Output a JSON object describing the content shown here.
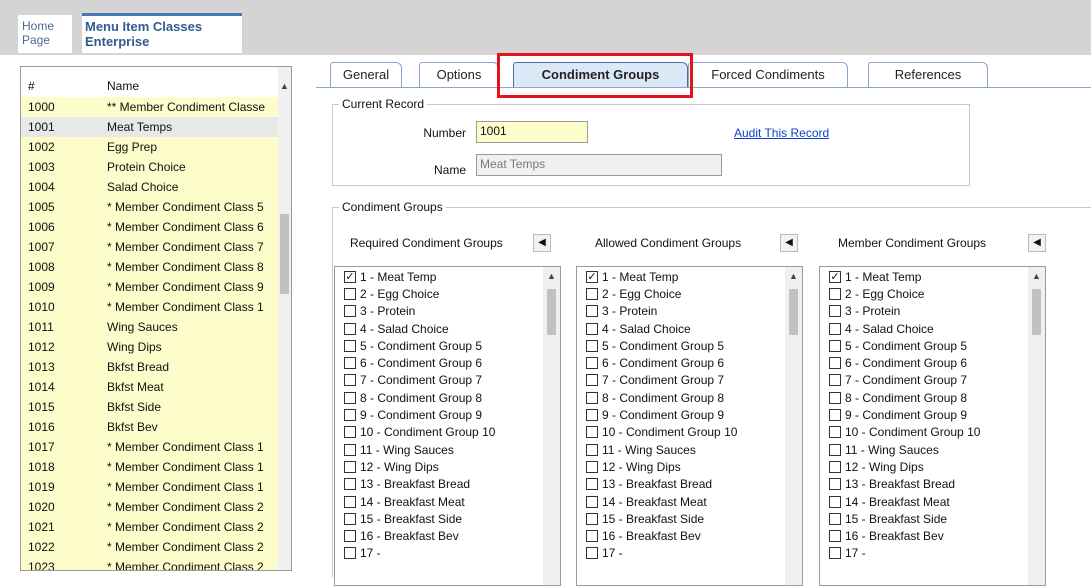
{
  "breadcrumb": {
    "home_line1": "Home",
    "home_line2": "Page",
    "active_line1": "Menu Item Classes",
    "active_line2": "Enterprise"
  },
  "list": {
    "col_num": "#",
    "col_name": "Name",
    "rows": [
      {
        "num": "1000",
        "name": "** Member Condiment Classe"
      },
      {
        "num": "1001",
        "name": "Meat Temps"
      },
      {
        "num": "1002",
        "name": "Egg Prep"
      },
      {
        "num": "1003",
        "name": "Protein Choice"
      },
      {
        "num": "1004",
        "name": "Salad Choice"
      },
      {
        "num": "1005",
        "name": "* Member Condiment Class 5"
      },
      {
        "num": "1006",
        "name": "* Member Condiment Class 6"
      },
      {
        "num": "1007",
        "name": "* Member Condiment Class 7"
      },
      {
        "num": "1008",
        "name": "* Member Condiment Class 8"
      },
      {
        "num": "1009",
        "name": "* Member Condiment Class 9"
      },
      {
        "num": "1010",
        "name": "* Member Condiment Class 1"
      },
      {
        "num": "1011",
        "name": "Wing Sauces"
      },
      {
        "num": "1012",
        "name": "Wing Dips"
      },
      {
        "num": "1013",
        "name": "Bkfst Bread"
      },
      {
        "num": "1014",
        "name": "Bkfst Meat"
      },
      {
        "num": "1015",
        "name": "Bkfst Side"
      },
      {
        "num": "1016",
        "name": "Bkfst Bev"
      },
      {
        "num": "1017",
        "name": "* Member Condiment Class 1"
      },
      {
        "num": "1018",
        "name": "* Member Condiment Class 1"
      },
      {
        "num": "1019",
        "name": "* Member Condiment Class 1"
      },
      {
        "num": "1020",
        "name": "* Member Condiment Class 2"
      },
      {
        "num": "1021",
        "name": "* Member Condiment Class 2"
      },
      {
        "num": "1022",
        "name": "* Member Condiment Class 2"
      },
      {
        "num": "1023",
        "name": "* Member Condiment Class 2"
      }
    ],
    "selected_index": 1
  },
  "tabs": [
    "General",
    "Options",
    "Condiment Groups",
    "Forced Condiments",
    "References"
  ],
  "active_tab": "Condiment Groups",
  "current_record": {
    "title": "Current Record",
    "number_label": "Number",
    "number_value": "1001",
    "name_label": "Name",
    "name_value": "Meat Temps",
    "audit_link": "Audit This Record"
  },
  "condiment_groups": {
    "title": "Condiment Groups",
    "columns": [
      {
        "label": "Required Condiment Groups"
      },
      {
        "label": "Allowed Condiment Groups"
      },
      {
        "label": "Member Condiment Groups"
      }
    ],
    "items": [
      "1 - Meat Temp",
      "2 - Egg Choice",
      "3 - Protein",
      "4 - Salad Choice",
      "5 - Condiment Group 5",
      "6 - Condiment Group 6",
      "7 - Condiment Group 7",
      "8 - Condiment Group 8",
      "9 - Condiment Group 9",
      "10 - Condiment Group 10",
      "11 - Wing Sauces",
      "12 - Wing Dips",
      "13 - Breakfast Bread",
      "14 - Breakfast Meat",
      "15 - Breakfast Side",
      "16 - Breakfast Bev",
      "17 -"
    ],
    "checked": [
      [
        0
      ],
      [
        0
      ],
      [
        0
      ]
    ]
  },
  "colors": {
    "highlight": "#e0141a",
    "list_row_bg": "#fdfccb",
    "link": "#0b44c8"
  }
}
